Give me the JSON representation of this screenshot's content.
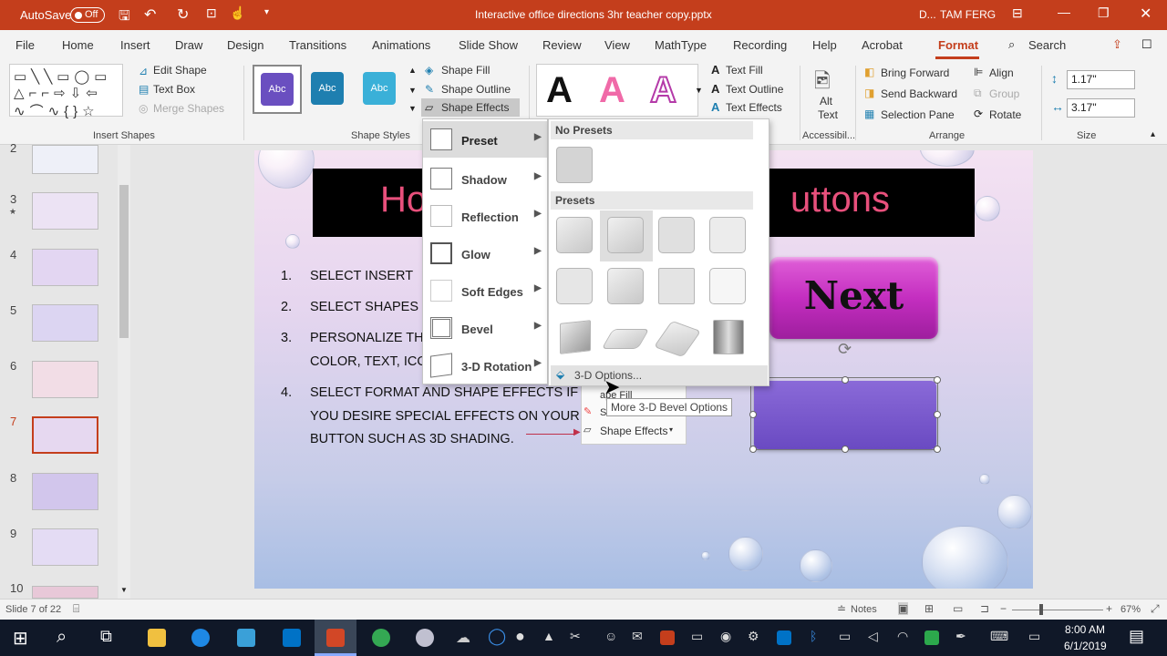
{
  "titlebar": {
    "autosave_label": "AutoSave",
    "autosave_state": "Off",
    "doc_title": "Interactive office directions 3hr teacher copy.pptx",
    "user_initials": "D...",
    "user_name": "TAM FERG"
  },
  "tabs": [
    "File",
    "Home",
    "Insert",
    "Draw",
    "Design",
    "Transitions",
    "Animations",
    "Slide Show",
    "Review",
    "View",
    "MathType",
    "Recording",
    "Help",
    "Acrobat",
    "Format"
  ],
  "active_tab": "Format",
  "search_label": "Search",
  "ribbon": {
    "insert_shapes": {
      "edit_shape": "Edit Shape",
      "text_box": "Text Box",
      "merge_shapes": "Merge Shapes",
      "group_label": "Insert Shapes"
    },
    "shape_styles": {
      "swatch_label": "Abc",
      "shape_fill": "Shape Fill",
      "shape_outline": "Shape Outline",
      "shape_effects": "Shape Effects",
      "group_label": "Shape Styles"
    },
    "wordart": {
      "letter": "A",
      "text_fill": "Text Fill",
      "text_outline": "Text Outline",
      "text_effects": "Text Effects"
    },
    "accessibility": {
      "alt_text_line1": "Alt",
      "alt_text_line2": "Text",
      "group_label": "Accessibil..."
    },
    "arrange": {
      "bring_forward": "Bring Forward",
      "send_backward": "Send Backward",
      "selection_pane": "Selection Pane",
      "align": "Align",
      "group": "Group",
      "rotate": "Rotate",
      "group_label": "Arrange"
    },
    "size": {
      "height": "1.17\"",
      "width": "3.17\"",
      "group_label": "Size"
    }
  },
  "shape_effects_menu": {
    "items": [
      "Preset",
      "Shadow",
      "Reflection",
      "Glow",
      "Soft Edges",
      "Bevel",
      "3-D Rotation"
    ],
    "submenu": {
      "no_presets_header": "No Presets",
      "presets_header": "Presets",
      "options_label": "3-D Options..."
    }
  },
  "tooltip": "More 3-D Bevel Options",
  "slide": {
    "title_left": "Ho",
    "title_right": "uttons",
    "next_button": "Next",
    "list": [
      {
        "num": "1.",
        "lines": [
          "SELECT INSERT"
        ]
      },
      {
        "num": "2.",
        "lines": [
          "SELECT SHAPES &"
        ]
      },
      {
        "num": "3.",
        "lines": [
          "PERSONALIZE TH",
          "COLOR, TEXT, ICO"
        ]
      },
      {
        "num": "4.",
        "lines": [
          "SELECT FORMAT AND SHAPE EFFECTS IF",
          "YOU DESIRE SPECIAL EFFECTS ON YOUR",
          "BUTTON SUCH AS 3D SHADING."
        ]
      }
    ],
    "mini_ribbon": {
      "shape_fill_partial": "ape Fill",
      "s_partial": "S",
      "shape_effects": "Shape Effects"
    }
  },
  "thumbnails": {
    "numbers": [
      "2",
      "3",
      "4",
      "5",
      "6",
      "7",
      "8",
      "9",
      "10"
    ],
    "active": "7",
    "star_marker": "★"
  },
  "statusbar": {
    "slide_info": "Slide 7 of 22",
    "notes": "Notes",
    "zoom": "67%"
  },
  "taskbar": {
    "time": "8:00 AM",
    "date": "6/1/2019"
  },
  "colors": {
    "brand": "#c43e1c",
    "accent_format": "#c43e1c",
    "next_button": "#c42ec0",
    "purple_button": "#6a4ac2",
    "swatch1": "#6a4fc0",
    "swatch2": "#1e7fb0",
    "swatch3": "#3ab0d8"
  }
}
